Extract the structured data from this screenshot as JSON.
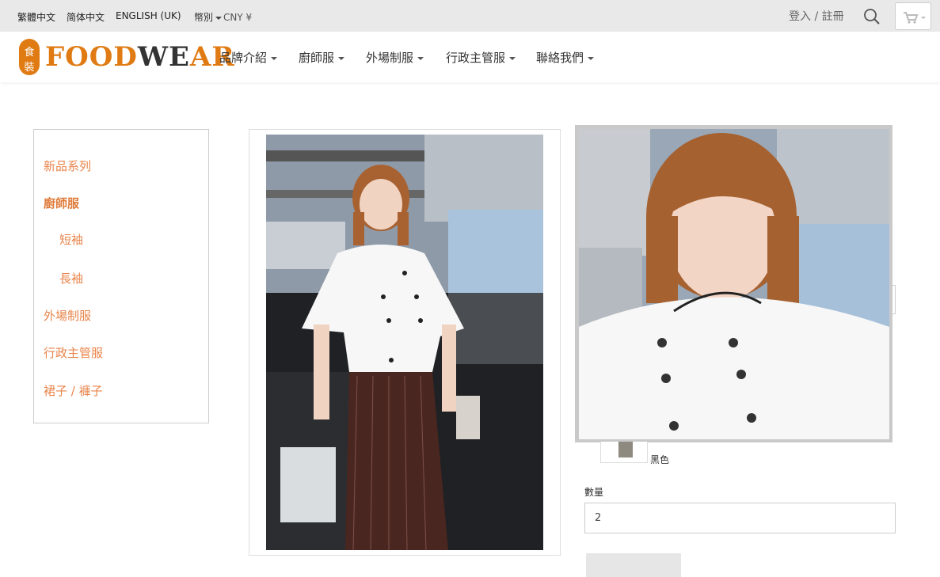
{
  "topbar": {
    "languages": [
      "繁體中文",
      "简体中文",
      "ENGLISH (UK)"
    ],
    "currency_label": "幣別",
    "currency_value": "CNY ¥",
    "login": "登入 / 註冊"
  },
  "logo": {
    "seal_top": "食",
    "seal_bottom": "裝",
    "word_part1": "FOOD",
    "word_part2": "WE",
    "word_part3": "AR"
  },
  "nav": [
    {
      "label": "品牌介紹"
    },
    {
      "label": "廚師服"
    },
    {
      "label": "外場制服"
    },
    {
      "label": "行政主管服"
    },
    {
      "label": "聯絡我們"
    }
  ],
  "sidebar": {
    "items": [
      {
        "label": "新品系列",
        "active": false
      },
      {
        "label": "廚師服",
        "active": true
      },
      {
        "label": "短袖",
        "active": false
      },
      {
        "label": "長袖",
        "active": false
      },
      {
        "label": "外場制服",
        "active": false
      },
      {
        "label": "行政主管服",
        "active": false
      },
      {
        "label": "裙子 / 褲子",
        "active": false
      }
    ]
  },
  "product": {
    "swatch_label": "黑色",
    "quantity_label": "數量",
    "quantity_value": "2"
  },
  "colors": {
    "accent": "#e07b14",
    "sidebar_text": "#e9844a",
    "topbar_bg": "#e9e9e9"
  }
}
